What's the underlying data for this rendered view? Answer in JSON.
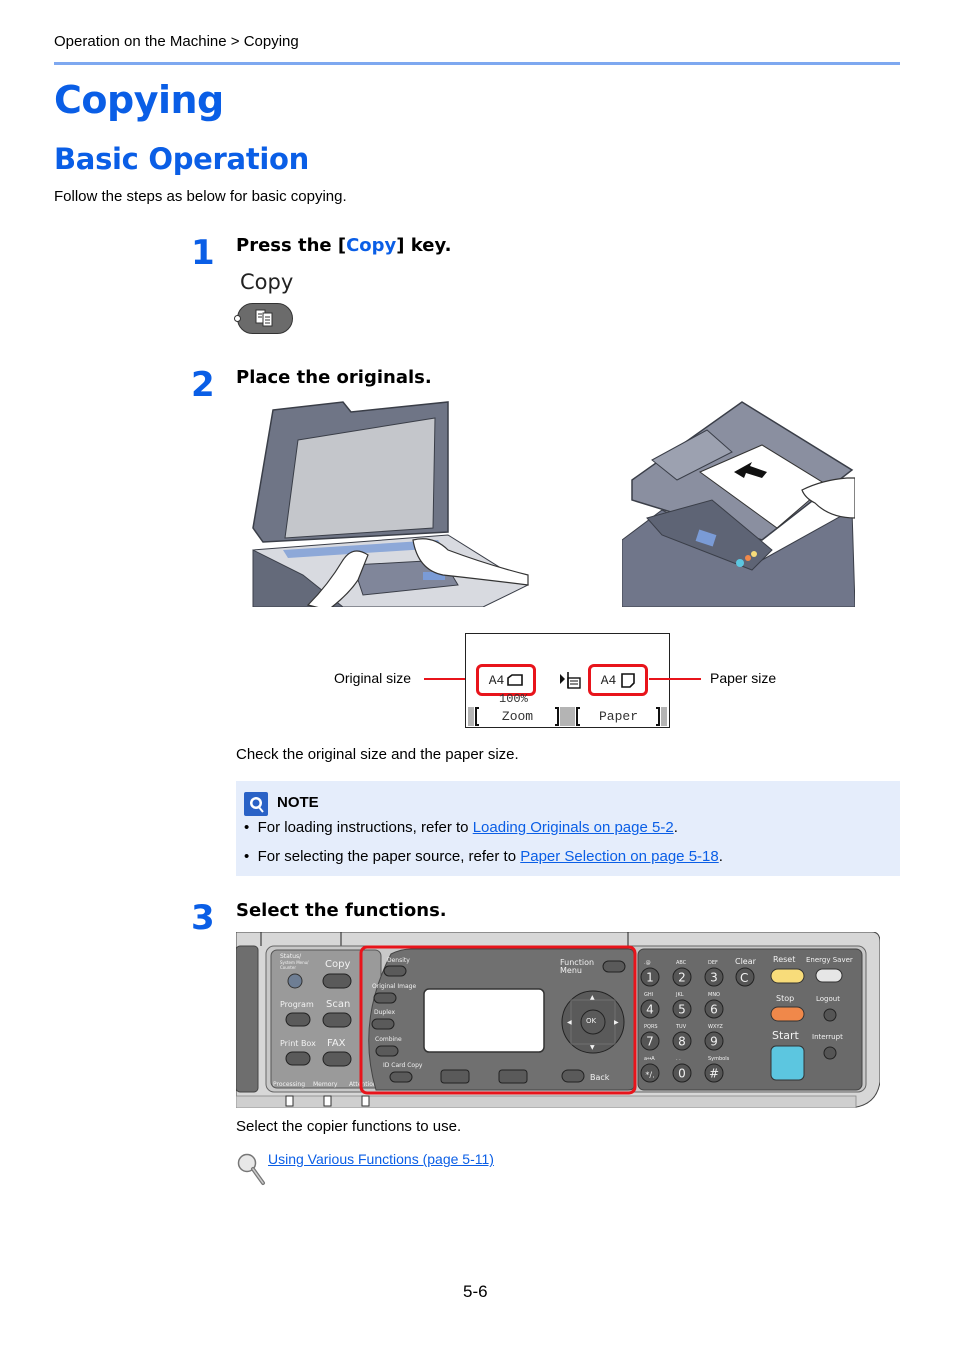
{
  "header": {
    "breadcrumb": "Operation on the Machine > Copying"
  },
  "title": "Copying",
  "section": {
    "title": "Basic Operation",
    "intro": "Follow the steps as below for basic copying."
  },
  "steps": [
    {
      "number": "1",
      "title_prefix": "Press the [",
      "title_key": "Copy",
      "title_suffix": "] key.",
      "key_label": "Copy",
      "key_icon": "copy-icon"
    },
    {
      "number": "2",
      "title": "Place the originals.",
      "illustrations": [
        "platen-glass-illustration",
        "document-processor-illustration"
      ],
      "lcd": {
        "original_size": "A4",
        "paper_size": "A4",
        "zoom_value": "100%",
        "softkey_left": "Zoom",
        "softkey_right": "Paper",
        "callout_left": "Original size",
        "callout_right": "Paper size"
      },
      "caption": "Check the original size and the paper size."
    },
    {
      "number": "3",
      "title": "Select the functions.",
      "caption": "Select the copier functions to use.",
      "reference_link": "Using Various Functions (page 5-11)"
    }
  ],
  "note": {
    "title": "NOTE",
    "items": [
      {
        "prefix": "For loading instructions, refer to ",
        "link": "Loading Originals on page 5-2",
        "suffix": "."
      },
      {
        "prefix": "For selecting the paper source, refer to ",
        "link": "Paper Selection on page 5-18",
        "suffix": "."
      }
    ]
  },
  "panel": {
    "left_keys": {
      "status": [
        "Status/",
        "System Menu/",
        "Counter"
      ],
      "copy": "Copy",
      "program": "Program",
      "scan": "Scan",
      "print_box": "Print Box",
      "fax": "FAX",
      "indicators": [
        "Processing",
        "Memory",
        "Attention"
      ]
    },
    "function_keys": [
      "Density",
      "Original Image",
      "Duplex",
      "Combine",
      "ID Card Copy"
    ],
    "function_menu": [
      "Function",
      "Menu"
    ],
    "back": "Back",
    "ok": "OK",
    "keypad": [
      {
        "key": "1",
        "sub": ".@"
      },
      {
        "key": "2",
        "sub": "ABC"
      },
      {
        "key": "3",
        "sub": "DEF"
      },
      {
        "key": "4",
        "sub": "GHI"
      },
      {
        "key": "5",
        "sub": "JKL"
      },
      {
        "key": "6",
        "sub": "MNO"
      },
      {
        "key": "7",
        "sub": "PQRS"
      },
      {
        "key": "8",
        "sub": "TUV"
      },
      {
        "key": "9",
        "sub": "WXYZ"
      },
      {
        "key": "*/.",
        "sub": "a↔A"
      },
      {
        "key": "0",
        "sub": ". ."
      },
      {
        "key": "#",
        "sub": "Symbols"
      }
    ],
    "clear": {
      "key": "C",
      "label": "Clear"
    },
    "reset": "Reset",
    "energy_saver": "Energy Saver",
    "stop": "Stop",
    "logout": "Logout",
    "start": "Start",
    "interrupt": "Interrupt",
    "colors": {
      "reset": "#f8dc7a",
      "stop": "#f0884a",
      "start": "#5cc6e0",
      "highlight": "#e8141b",
      "panel": "#6e6e6e"
    }
  },
  "footer": {
    "page_number": "5-6"
  }
}
